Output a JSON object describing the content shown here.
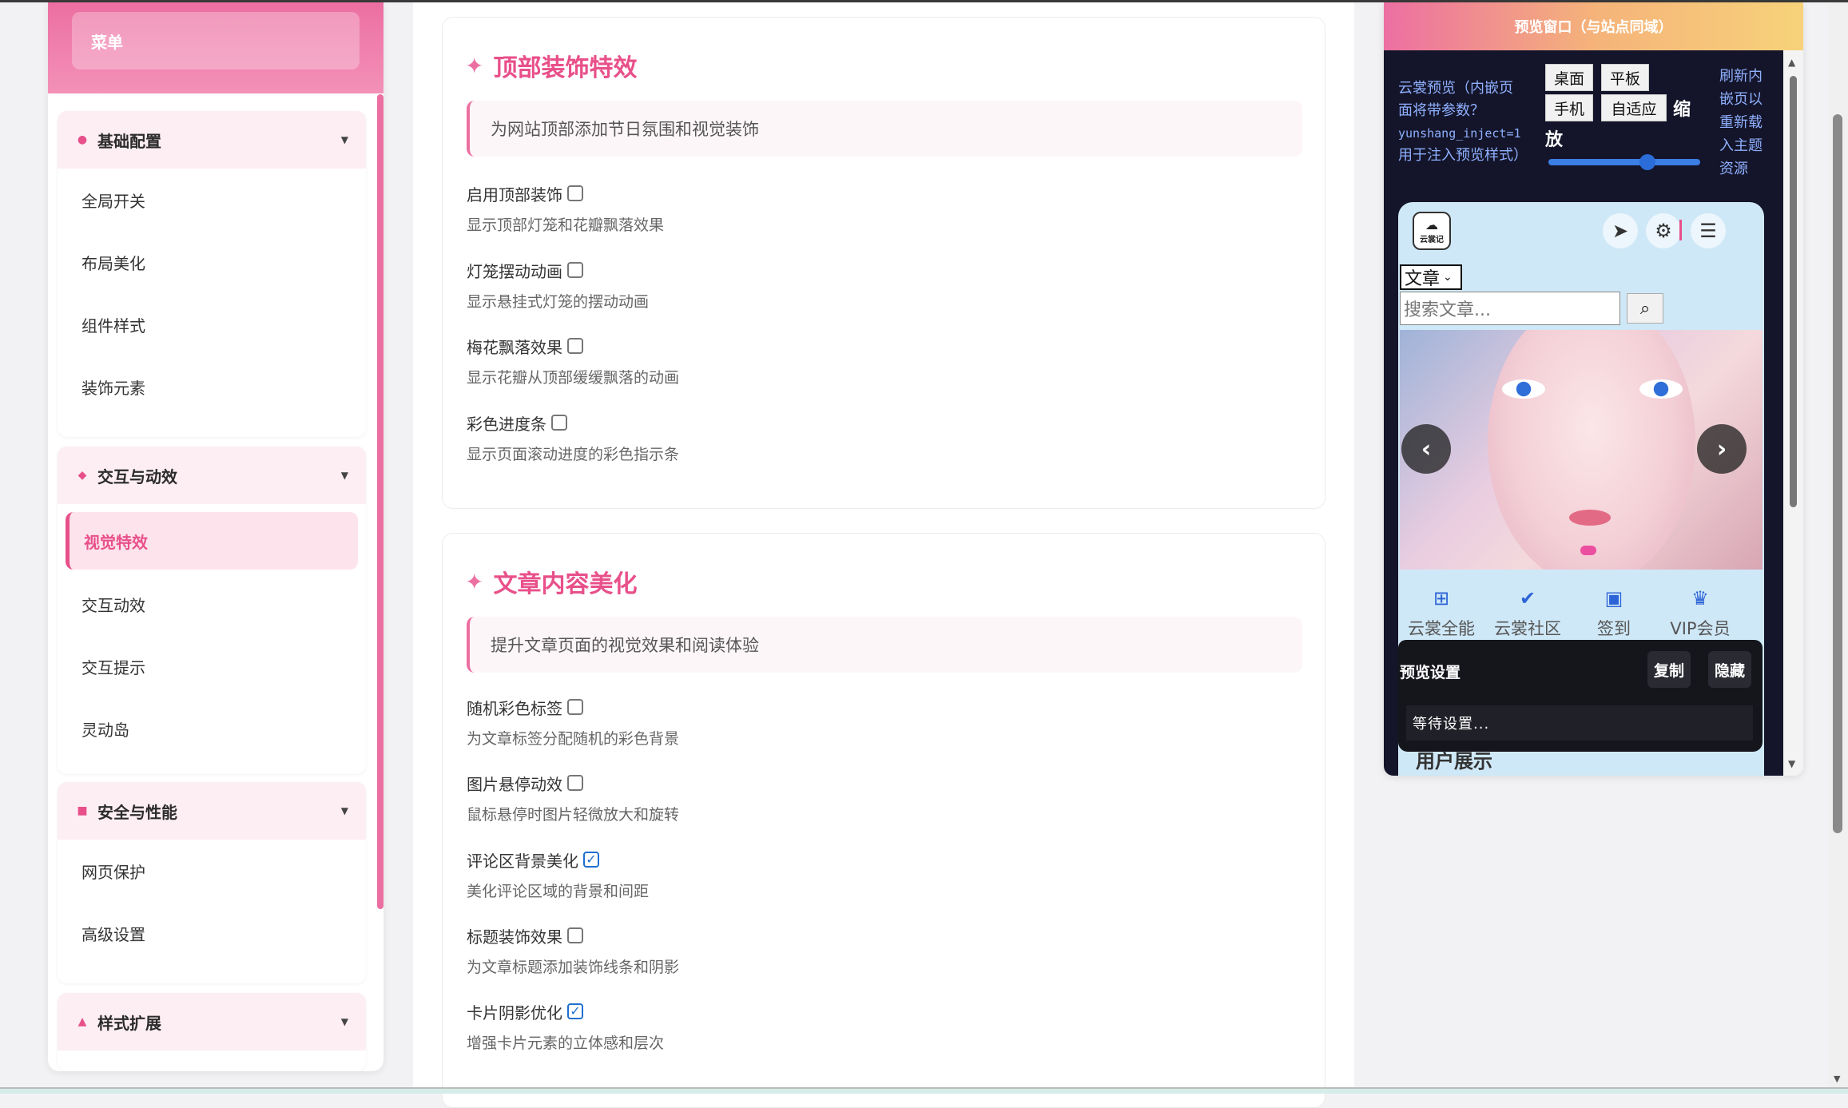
{
  "sidebar": {
    "menu_label": "菜单",
    "groups": [
      {
        "label": "基础配置",
        "icon": "dot-icon",
        "items": [
          "全局开关",
          "布局美化",
          "组件样式",
          "装饰元素"
        ]
      },
      {
        "label": "交互与动效",
        "icon": "diamond-icon",
        "items": [
          "视觉特效",
          "交互动效",
          "交互提示",
          "灵动岛"
        ],
        "active": "视觉特效"
      },
      {
        "label": "安全与性能",
        "icon": "square-icon",
        "items": [
          "网页保护",
          "高级设置"
        ]
      },
      {
        "label": "样式扩展",
        "icon": "triangle-icon",
        "items": []
      }
    ]
  },
  "sections": [
    {
      "title": "顶部装饰特效",
      "description": "为网站顶部添加节日氛围和视觉装饰",
      "options": [
        {
          "label": "启用顶部装饰",
          "checked": false,
          "desc": "显示顶部灯笼和花瓣飘落效果"
        },
        {
          "label": "灯笼摆动动画",
          "checked": false,
          "desc": "显示悬挂式灯笼的摆动动画"
        },
        {
          "label": "梅花飘落效果",
          "checked": false,
          "desc": "显示花瓣从顶部缓缓飘落的动画"
        },
        {
          "label": "彩色进度条",
          "checked": false,
          "desc": "显示页面滚动进度的彩色指示条"
        }
      ]
    },
    {
      "title": "文章内容美化",
      "description": "提升文章页面的视觉效果和阅读体验",
      "options": [
        {
          "label": "随机彩色标签",
          "checked": false,
          "desc": "为文章标签分配随机的彩色背景"
        },
        {
          "label": "图片悬停动效",
          "checked": false,
          "desc": "鼠标悬停时图片轻微放大和旋转"
        },
        {
          "label": "评论区背景美化",
          "checked": true,
          "desc": "美化评论区域的背景和间距"
        },
        {
          "label": "标题装饰效果",
          "checked": false,
          "desc": "为文章标题添加装饰线条和阴影"
        },
        {
          "label": "卡片阴影优化",
          "checked": true,
          "desc": "增强卡片元素的立体感和层次"
        }
      ]
    }
  ],
  "preview": {
    "title": "预览窗口（与站点同域）",
    "info_line1": "云裳预览（内嵌页",
    "info_line2": "面将带参数？",
    "info_param": "yunshang_inject=1",
    "info_line3": "用于注入预览样式）",
    "devices": {
      "desktop": "桌面",
      "tablet": "平板",
      "mobile": "手机",
      "adaptive": "自适应"
    },
    "zoom_part1": "缩",
    "zoom_part2": "放",
    "zoom_value": 0.65,
    "refresh_text": "刷新内嵌页以重新载入主题资源",
    "phone": {
      "logo_text": "云裳记",
      "select_value": "文章",
      "search_placeholder": "搜索文章...",
      "nav_items": [
        {
          "icon": "grid-icon",
          "label": "云裳全能"
        },
        {
          "icon": "check-circle-icon",
          "label": "云裳社区"
        },
        {
          "icon": "calendar-check-icon",
          "label": "签到"
        },
        {
          "icon": "crown-icon",
          "label": "VIP会员"
        }
      ],
      "overlay_title": "预览设置",
      "copy_label": "复制",
      "hide_label": "隐藏",
      "status_text": "等待设置...",
      "under_text": "用户展示"
    }
  },
  "colors": {
    "accent": "#e8508a",
    "accent_light": "#fdeef3",
    "preview_bg": "#14152a",
    "link_blue": "#8fb0ff"
  }
}
